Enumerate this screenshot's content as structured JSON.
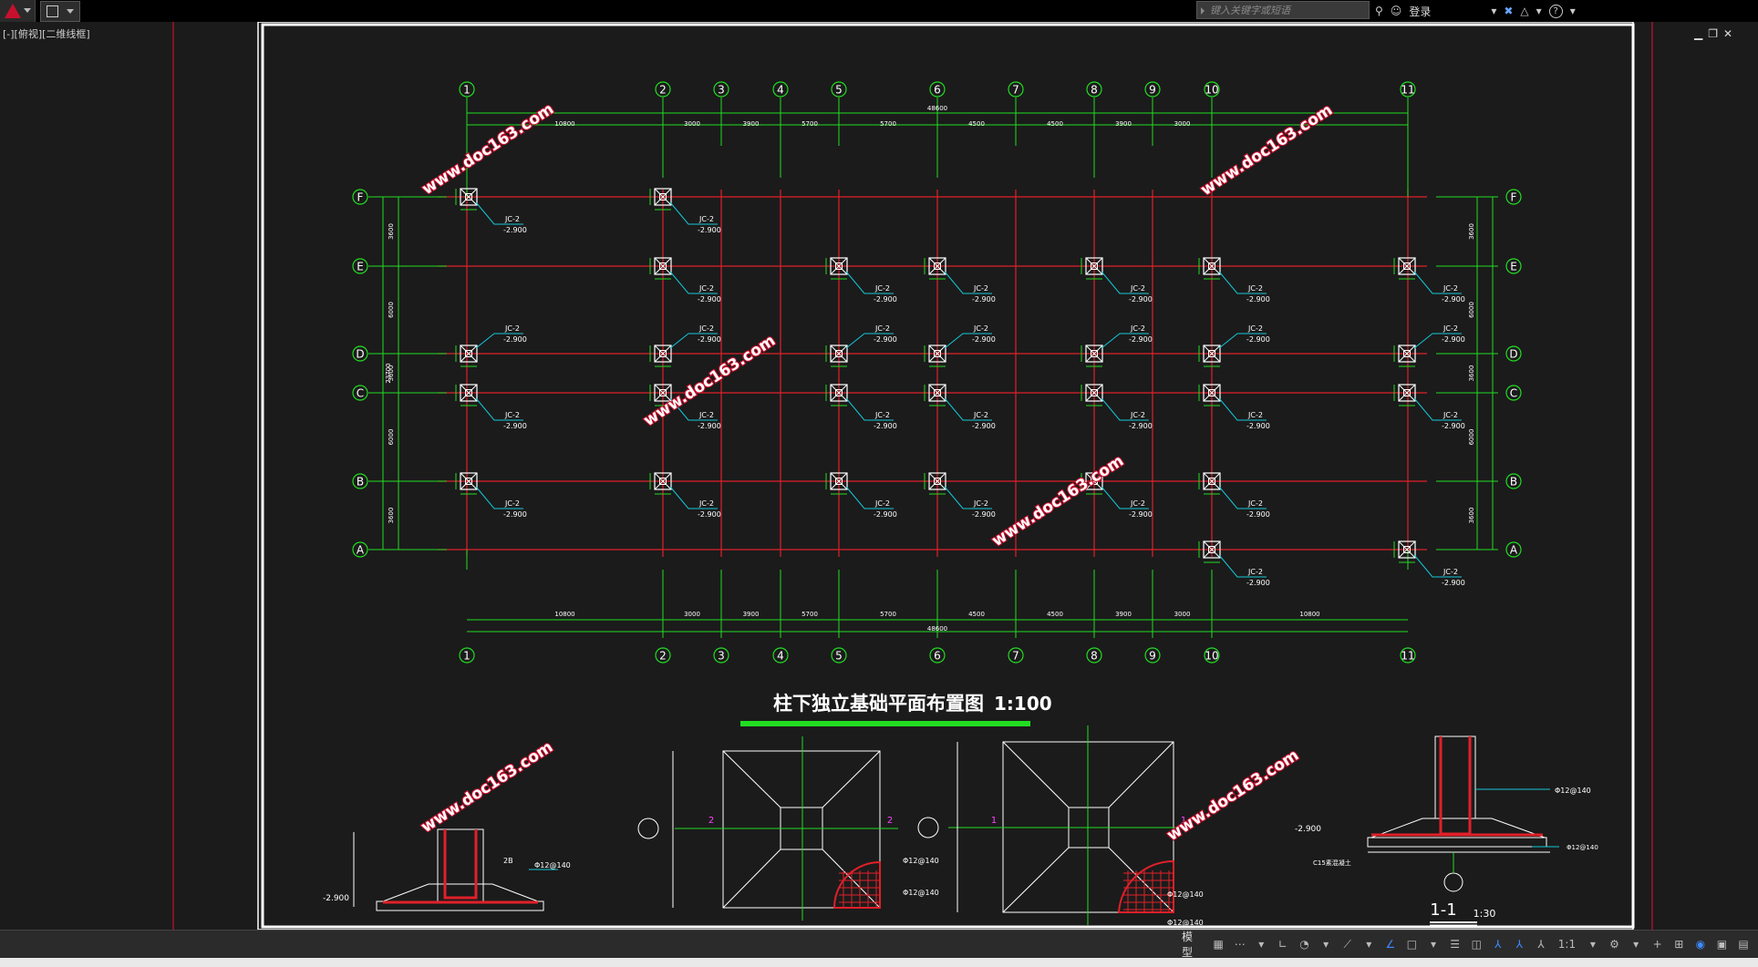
{
  "toolbar": {
    "search_placeholder": "键入关键字或短语",
    "login_label": "登录",
    "help_label": "?"
  },
  "viewport": {
    "label": "[-][俯视][二维线框]"
  },
  "drawing": {
    "column_grid_labels": [
      "1",
      "2",
      "3",
      "4",
      "5",
      "6",
      "7",
      "8",
      "9",
      "10",
      "11"
    ],
    "row_grid_labels": [
      "F",
      "E",
      "D",
      "C",
      "B",
      "A"
    ],
    "top_dimensions": [
      "10800",
      "3000",
      "3900",
      "5700",
      "5700",
      "4500",
      "4500",
      "3900",
      "3000"
    ],
    "total_dimension": "48600",
    "bottom_dimensions": [
      "10800",
      "3000",
      "3900",
      "5700",
      "5700",
      "4500",
      "4500",
      "3900",
      "3000",
      "10800"
    ],
    "left_dimensions": [
      "3600",
      "6000",
      "3600",
      "6000",
      "3600"
    ],
    "left_total": "23700",
    "foundation_label": "JC-2",
    "foundation_elevation": "-2.900",
    "plan_title": "柱下独立基础平面布置图",
    "plan_scale": "1:100",
    "watermark": "www.doc163.com",
    "detail_labels": {
      "rebar_1": "Φ12@140",
      "rebar_2": "Φ12@140",
      "elevation": "-2.900",
      "section_mark_2": "2",
      "section_mark_1": "1",
      "section_title": "1-1",
      "section_scale": "1:30",
      "c15": "C15素混凝土",
      "label_2b": "2B"
    }
  },
  "status": {
    "model_label": "模型",
    "scale_label": "1:1"
  },
  "colors": {
    "grid_red": "#e0202a",
    "dim_green": "#22dd22",
    "leader_cyan": "#14c8d8",
    "frame_white": "#ffffff",
    "background": "#1b1b1b"
  }
}
